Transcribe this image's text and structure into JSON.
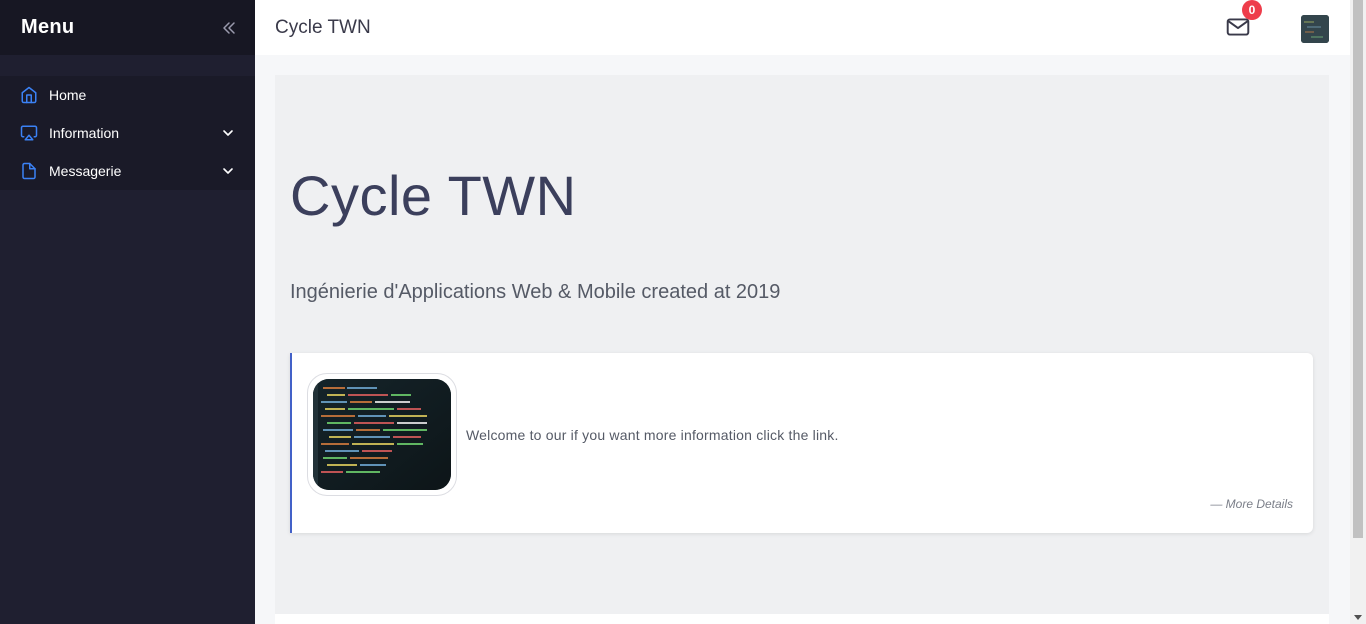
{
  "sidebar": {
    "brand": "Menu",
    "collapse_icon": "double-chevron-left-icon",
    "items": [
      {
        "label": "Home",
        "icon": "home-icon",
        "has_submenu": false
      },
      {
        "label": "Information",
        "icon": "monitor-icon",
        "has_submenu": true
      },
      {
        "label": "Messagerie",
        "icon": "file-icon",
        "has_submenu": true
      }
    ]
  },
  "header": {
    "title": "Cycle TWN",
    "mail_icon": "mail-icon",
    "unread_count": "0"
  },
  "main": {
    "hero_title": "Cycle TWN",
    "hero_subtitle": "Ingénierie d'Applications Web & Mobile created at 2019",
    "card": {
      "text": "Welcome to our if you want more information click the link.",
      "link": "— More Details"
    }
  },
  "colors": {
    "sidebar_bg": "#1f1f30",
    "accent_blue": "#4361c8",
    "badge_red": "#ee3d4b",
    "icon_blue": "#3b82f6"
  }
}
